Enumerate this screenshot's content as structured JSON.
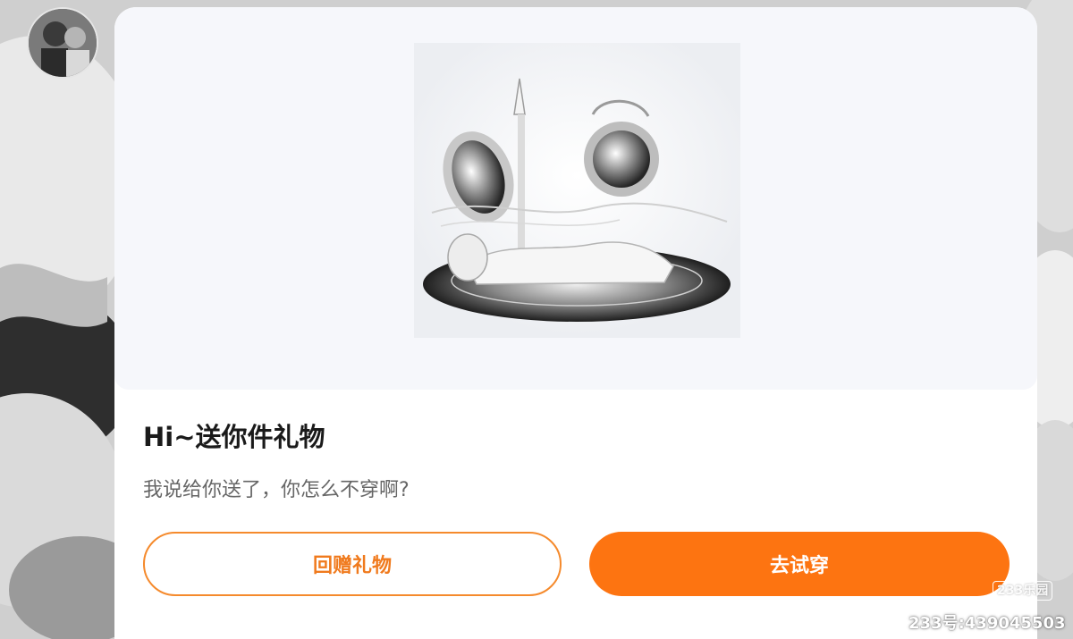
{
  "dialog": {
    "title": "Hi~送你件礼物",
    "message": "我说给你送了，你怎么不穿啊?",
    "buttons": {
      "return_gift_label": "回赠礼物",
      "try_on_label": "去试穿"
    }
  },
  "watermark": {
    "logo": "233乐园",
    "id_text": "233号:439045503"
  },
  "colors": {
    "primary_orange": "#fd7411",
    "outline_orange": "#f58a2c",
    "title_text": "#1a1a1a",
    "message_text": "#666666",
    "gift_area_bg": "#f6f7fb"
  }
}
